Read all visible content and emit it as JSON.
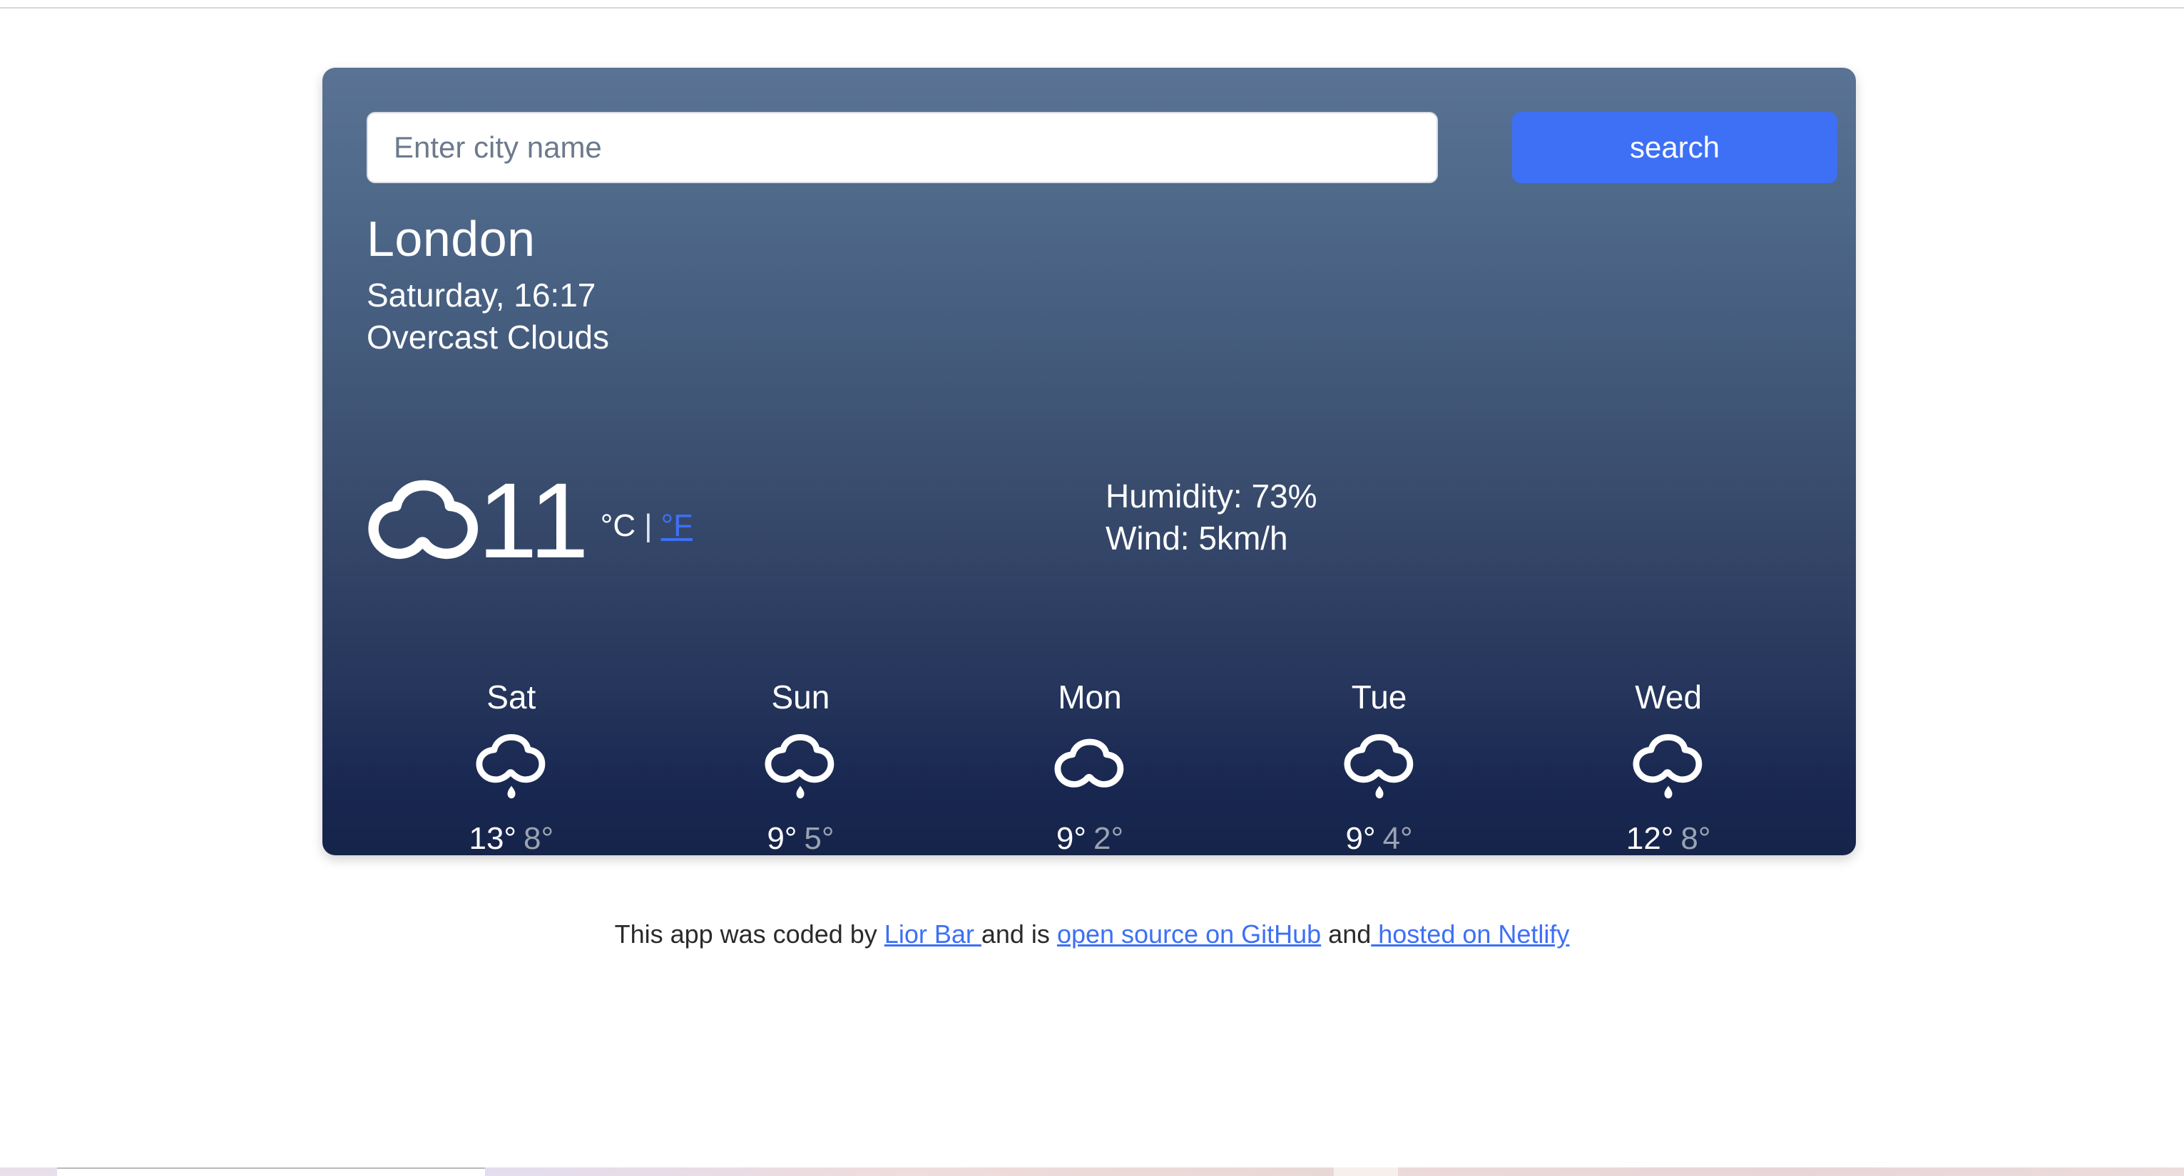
{
  "search": {
    "placeholder": "Enter city name",
    "value": "",
    "button_label": "search"
  },
  "current": {
    "city": "London",
    "datetime": "Saturday, 16:17",
    "condition": "Overcast Clouds",
    "temperature": "11",
    "unit_celsius_label": "°C",
    "unit_separator": "|",
    "unit_fahrenheit_label": "°F",
    "humidity": "Humidity: 73%",
    "wind": "Wind: 5km/h",
    "icon": "cloud-icon"
  },
  "forecast": {
    "days": [
      {
        "day": "Sat",
        "icon": "rain-cloud-icon",
        "max": "13°",
        "min": "8°"
      },
      {
        "day": "Sun",
        "icon": "rain-cloud-icon",
        "max": "9°",
        "min": "5°"
      },
      {
        "day": "Mon",
        "icon": "cloud-icon",
        "max": "9°",
        "min": "2°"
      },
      {
        "day": "Tue",
        "icon": "rain-cloud-icon",
        "max": "9°",
        "min": "4°"
      },
      {
        "day": "Wed",
        "icon": "rain-cloud-icon",
        "max": "12°",
        "min": "8°"
      }
    ]
  },
  "footer": {
    "text_1": "This app was coded by ",
    "link_author": "Lior Bar ",
    "text_2": "and is ",
    "link_source": "open source on GitHub",
    "text_3": " and",
    "link_host": " hosted on Netlify"
  },
  "colors": {
    "accent_blue": "#3d70f5",
    "card_top": "#5a7394",
    "card_bottom": "#16244a",
    "min_temp_gray": "#9aa3b2"
  }
}
